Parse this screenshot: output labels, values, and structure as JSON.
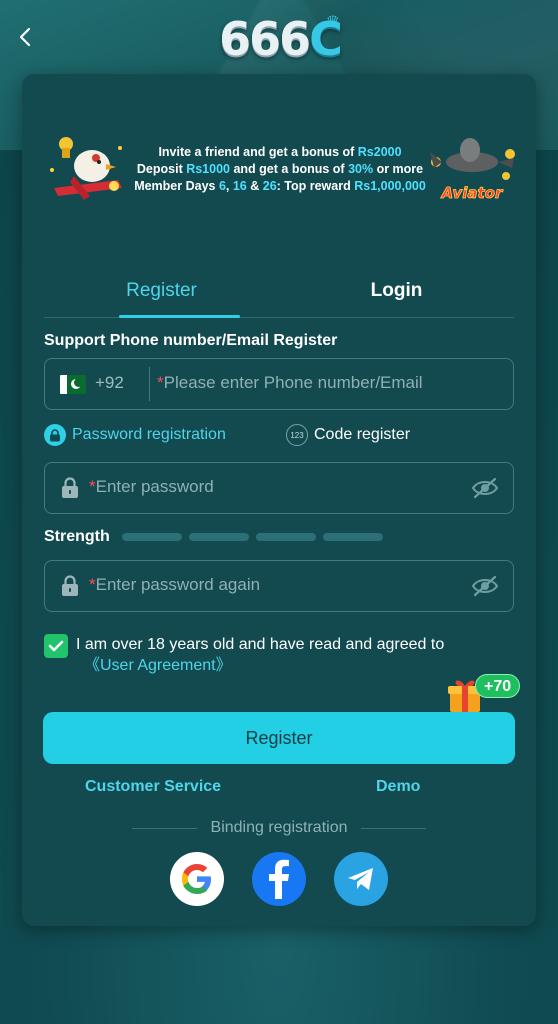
{
  "header": {
    "back_icon": "chevron-left-icon",
    "logo_text_digits": "666",
    "logo_text_letter": "C"
  },
  "banner": {
    "line1_prefix": "Invite a friend and get a bonus of ",
    "line1_amount": "Rs2000",
    "line2_a": "Deposit ",
    "line2_amount": "Rs1000",
    "line2_b": " and get a bonus of ",
    "line2_pct": "30%",
    "line2_c": " or more",
    "line3_a": "Member Days ",
    "line3_d1": "6",
    "line3_sep1": ", ",
    "line3_d2": "16",
    "line3_sep2": " & ",
    "line3_d3": "26",
    "line3_b": ": Top reward ",
    "line3_amount": "Rs1,000,000",
    "aviator_label": "Aviator"
  },
  "tabs": [
    {
      "label": "Register",
      "active": true
    },
    {
      "label": "Login",
      "active": false
    }
  ],
  "form": {
    "section_title": "Support Phone number/Email Register",
    "country_code": "+92",
    "required_mark": "*",
    "phone_placeholder": "Please enter Phone number/Email",
    "mode_password": "Password registration",
    "mode_code": "Code register",
    "code_icon_text": "123",
    "password_placeholder": "Enter password",
    "strength_label": "Strength",
    "strength_level": 0,
    "password_again_placeholder": "Enter password again",
    "agree_checked": true,
    "agree_text": "I am over 18 years old and have read and agreed to",
    "agree_link": "《User Agreement》"
  },
  "bonus": {
    "badge": "+70"
  },
  "register_button": "Register",
  "links": {
    "customer_service": "Customer Service",
    "demo": "Demo"
  },
  "binding": {
    "title": "Binding registration",
    "providers": [
      "google-icon",
      "facebook-icon",
      "telegram-icon"
    ]
  },
  "colors": {
    "accent": "#23cfe4",
    "card_bg": "#124a50",
    "required": "#ff4d4f",
    "check": "#21c46b"
  }
}
